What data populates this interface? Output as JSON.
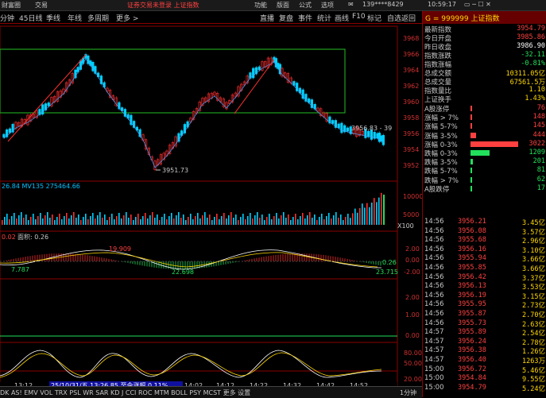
{
  "menu": {
    "items": [
      "财富圈",
      "交易"
    ],
    "notice": "证券交易未登录  上证指数",
    "right_items": [
      "功能",
      "版面",
      "公式",
      "选项"
    ],
    "account": "139****8429",
    "clock": "10:59:17"
  },
  "toolbar": {
    "left": [
      "分钟",
      "45日线",
      "季线",
      "年线",
      "多周期",
      "更多 >"
    ],
    "right": [
      "直播",
      "复盘",
      "事件",
      "统计",
      "画线",
      "F10",
      "标记",
      "自选返回"
    ]
  },
  "chart": {
    "price_ticks": [
      "3968",
      "3966",
      "3964",
      "3962",
      "3960",
      "3958",
      "3956",
      "3954",
      "3952"
    ],
    "price_label_low": "3951.73",
    "price_label_current": "3956.83 - 39",
    "vol_label": "26.84  MV135 275464.66",
    "vol_ticks": [
      "10000",
      "5000"
    ],
    "vol_x": "X100",
    "macd_label": "面积: 0.26",
    "macd_prefix": "0.02",
    "macd_values": [
      "19.909",
      "7.787",
      "22.698",
      "0.26",
      "23.715"
    ],
    "macd_ticks": [
      "2.00",
      "0.00",
      "-2.00"
    ],
    "mid_ticks": [
      "2.00",
      "1.00",
      "0.00"
    ],
    "kdj_ticks": [
      "80.00",
      "50.00",
      "20.00"
    ],
    "time_axis": [
      "13:12",
      "13:26",
      "14:02",
      "14:12",
      "14:22",
      "14:32",
      "14:42",
      "14:52"
    ],
    "time_status": "25/10/31/五 13:26.85 至今涨幅 0.11%",
    "indicators": "DK AS! EMV VOL TRX PSL WR SAR KD J CCI ROC MTM BOLL PSY MCST  更多  设置",
    "period_btn": "1分钟"
  },
  "quote": {
    "code_label": "G = 999999 上证指数",
    "fields": [
      {
        "label": "最新指数",
        "value": "3954.79",
        "color": "red"
      },
      {
        "label": "今日开盘",
        "value": "3985.86",
        "color": "red"
      },
      {
        "label": "昨日收盘",
        "value": "3986.90",
        "color": "white"
      },
      {
        "label": "指数涨跌",
        "value": "-32.11",
        "color": "green"
      },
      {
        "label": "指数涨幅",
        "value": "-0.81%",
        "color": "green"
      },
      {
        "label": "总成交额",
        "value": "10311.05亿",
        "color": "yellow"
      },
      {
        "label": "总成交量",
        "value": "67561.5万",
        "color": "yellow"
      },
      {
        "label": "指数量比",
        "value": "1.10",
        "color": "yellow"
      },
      {
        "label": "上证换手",
        "value": "1.43%",
        "color": "yellow"
      }
    ],
    "dist": [
      {
        "label": "A股涨停",
        "value": "76",
        "color": "red",
        "bar": 0.02
      },
      {
        "label": "涨幅 > 7%",
        "value": "148",
        "color": "red",
        "bar": 0.03
      },
      {
        "label": "涨幅 5-7%",
        "value": "145",
        "color": "red",
        "bar": 0.03
      },
      {
        "label": "涨幅 3-5%",
        "value": "444",
        "color": "red",
        "bar": 0.12
      },
      {
        "label": "涨幅 0-3%",
        "value": "3022",
        "color": "red",
        "bar": 1.0
      },
      {
        "label": "跌幅 0-3%",
        "value": "1209",
        "color": "green",
        "bar": 0.4
      },
      {
        "label": "跌幅 3-5%",
        "value": "201",
        "color": "green",
        "bar": 0.05
      },
      {
        "label": "跌幅 5-7%",
        "value": "81",
        "color": "green",
        "bar": 0.02
      },
      {
        "label": "跌幅 > 7%",
        "value": "62",
        "color": "green",
        "bar": 0.015
      },
      {
        "label": "A股跌停",
        "value": "17",
        "color": "green",
        "bar": 0.005
      }
    ],
    "ticks": [
      {
        "t": "14:56",
        "p": "3956.21",
        "v": "3.45亿",
        "c": "red"
      },
      {
        "t": "14:56",
        "p": "3956.08",
        "v": "3.57亿",
        "c": "red"
      },
      {
        "t": "14:56",
        "p": "3955.68",
        "v": "2.96亿",
        "c": "red"
      },
      {
        "t": "14:56",
        "p": "3956.16",
        "v": "3.10亿",
        "c": "red"
      },
      {
        "t": "14:56",
        "p": "3955.94",
        "v": "3.66亿",
        "c": "red"
      },
      {
        "t": "14:56",
        "p": "3955.85",
        "v": "3.66亿",
        "c": "red"
      },
      {
        "t": "14:56",
        "p": "3956.42",
        "v": "3.37亿",
        "c": "red"
      },
      {
        "t": "14:56",
        "p": "3956.13",
        "v": "3.53亿",
        "c": "red"
      },
      {
        "t": "14:56",
        "p": "3956.19",
        "v": "3.15亿",
        "c": "red"
      },
      {
        "t": "14:56",
        "p": "3955.95",
        "v": "2.73亿",
        "c": "red"
      },
      {
        "t": "14:56",
        "p": "3955.87",
        "v": "2.70亿",
        "c": "red"
      },
      {
        "t": "14:56",
        "p": "3955.73",
        "v": "2.63亿",
        "c": "red"
      },
      {
        "t": "14:57",
        "p": "3955.89",
        "v": "2.54亿",
        "c": "red"
      },
      {
        "t": "14:57",
        "p": "3956.24",
        "v": "2.78亿",
        "c": "red"
      },
      {
        "t": "14:57",
        "p": "3956.38",
        "v": "1.26亿",
        "c": "red"
      },
      {
        "t": "14:57",
        "p": "3956.40",
        "v": "1263万",
        "c": "red"
      },
      {
        "t": "15:00",
        "p": "3956.72",
        "v": "5.46亿",
        "c": "red"
      },
      {
        "t": "15:00",
        "p": "3954.84",
        "v": "9.55亿",
        "c": "red"
      },
      {
        "t": "15:00",
        "p": "3954.79",
        "v": "5.24亿",
        "c": "red"
      }
    ]
  }
}
